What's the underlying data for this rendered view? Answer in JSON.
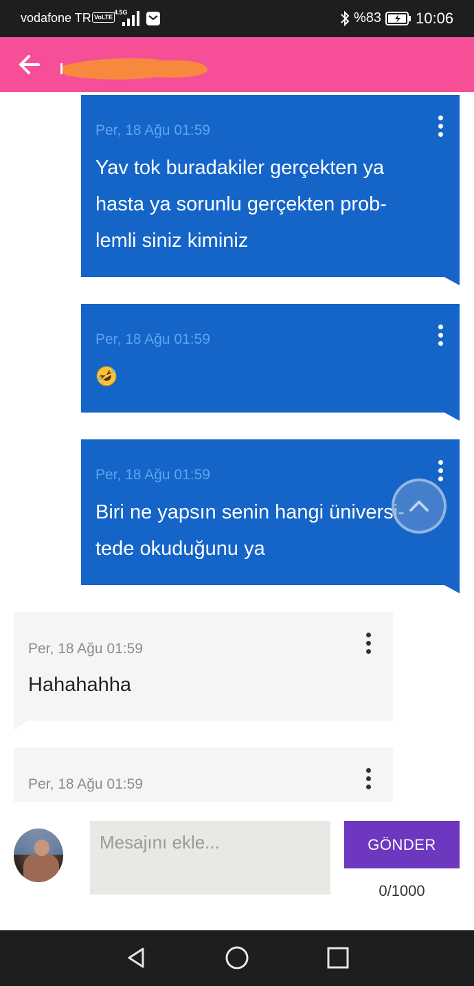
{
  "status_bar": {
    "carrier": "vodafone TR",
    "volte": "VoLTE",
    "network": "4.5G",
    "battery_percent": "%83",
    "time": "10:06"
  },
  "header": {
    "back_icon": "arrow-left-icon",
    "title_redacted": true
  },
  "colors": {
    "header": "#f64f97",
    "outgoing_bubble": "#1565c8",
    "incoming_bubble": "#f5f5f5",
    "send_button": "#6e37bf",
    "status_bar": "#1e1e1e"
  },
  "messages": [
    {
      "direction": "outgoing",
      "timestamp": "Per, 18 Ağu 01:59",
      "text_lines": [
        "Yav tok buradakiler gerçekten ya",
        "hasta ya sorunlu gerçekten prob-",
        "lemli siniz kiminiz"
      ]
    },
    {
      "direction": "outgoing",
      "timestamp": "Per, 18 Ağu 01:59",
      "emoji": "rolling-on-floor-laughing"
    },
    {
      "direction": "outgoing",
      "timestamp": "Per, 18 Ağu 01:59",
      "text_lines": [
        "Biri ne yapsın senin hangi üniversi-",
        "tede okuduğunu ya"
      ]
    },
    {
      "direction": "incoming",
      "timestamp": "Per, 18 Ağu 01:59",
      "text_lines": [
        "Hahahahha"
      ]
    },
    {
      "direction": "incoming",
      "timestamp": "Per, 18 Ağu 01:59"
    }
  ],
  "composer": {
    "placeholder": "Mesajını ekle...",
    "send_label": "GÖNDER",
    "counter": "0/1000"
  },
  "icons": {
    "message_menu": "more-vertical-icon",
    "scroll_top": "chevron-up-icon",
    "nav_back": "triangle-back-icon",
    "nav_home": "circle-home-icon",
    "nav_recents": "square-recents-icon"
  }
}
